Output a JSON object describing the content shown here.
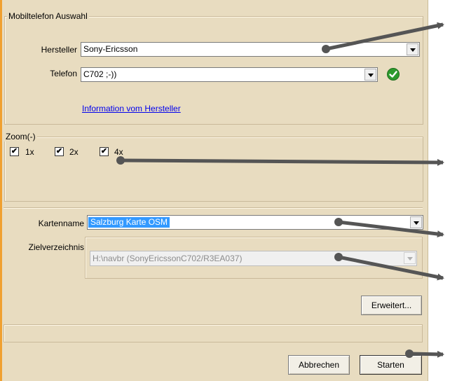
{
  "phone_group": {
    "title": "Mobiltelefon Auswahl",
    "manufacturer_label": "Hersteller",
    "manufacturer_value": "Sony-Ericsson",
    "phone_label": "Telefon",
    "phone_value": "C702 ;-))",
    "info_link": "Information vom Hersteller"
  },
  "zoom_group": {
    "title": "Zoom(-)",
    "options": [
      {
        "label": "1x",
        "checked": true
      },
      {
        "label": "2x",
        "checked": true
      },
      {
        "label": "4x",
        "checked": true
      }
    ]
  },
  "map": {
    "name_label": "Kartenname",
    "name_value": "Salzburg Karte OSM",
    "dir_label": "Zielverzeichnis",
    "dir_value": "H:\\navbr (SonyEricssonC702/R3EA037)"
  },
  "buttons": {
    "advanced": "Erweitert...",
    "cancel": "Abbrechen",
    "start": "Starten"
  },
  "colors": {
    "window_bg": "#e8dcc0",
    "accent_edge": "#f0a030",
    "selection": "#3399ff",
    "ok_green": "#2c9a2c",
    "arrow": "#555555"
  }
}
